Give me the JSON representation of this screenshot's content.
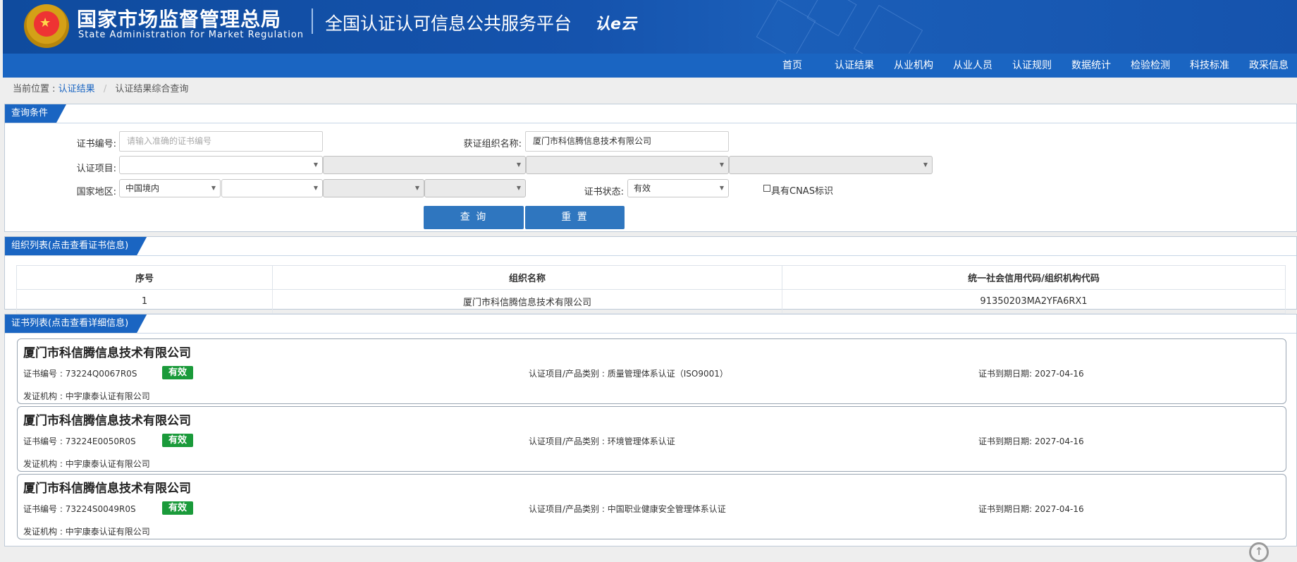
{
  "header": {
    "agency_cn": "国家市场监督管理总局",
    "agency_en": "State Administration  for  Market Regulation",
    "platform_title": "全国认证认可信息公共服务平台",
    "cloud_logo": "认e云"
  },
  "nav": [
    "首页",
    "认证结果",
    "从业机构",
    "从业人员",
    "认证规则",
    "数据统计",
    "检验检测",
    "科技标准",
    "政采信息"
  ],
  "breadcrumb": {
    "prefix": "当前位置 :",
    "link": "认证结果",
    "separator": "/",
    "current": "认证结果综合查询"
  },
  "query": {
    "tab": "查询条件",
    "cert_no_label": "证书编号:",
    "cert_no_placeholder": "请输入准确的证书编号",
    "org_name_label": "获证组织名称:",
    "org_name_value": "厦门市科信腾信息技术有限公司",
    "project_label": "认证项目:",
    "region_label": "国家地区:",
    "region_value": "中国境内",
    "status_label": "证书状态:",
    "status_value": "有效",
    "cnas_label": "具有CNAS标识",
    "query_button": "查 询",
    "reset_button": "重 置"
  },
  "org_list": {
    "tab": "组织列表(点击查看证书信息)",
    "columns": [
      "序号",
      "组织名称",
      "统一社会信用代码/组织机构代码"
    ],
    "rows": [
      [
        "1",
        "厦门市科信腾信息技术有限公司",
        "91350203MA2YFA6RX1"
      ]
    ]
  },
  "cert_list": {
    "tab": "证书列表(点击查看详细信息)",
    "cert_no_prefix": "证书编号 :",
    "category_prefix": "认证项目/产品类别 :",
    "expiry_prefix": "证书到期日期:",
    "issuer_prefix": "发证机构 :",
    "items": [
      {
        "org": "厦门市科信腾信息技术有限公司",
        "cert_no": "73224Q0067R0S",
        "status": "有效",
        "category": "质量管理体系认证（ISO9001）",
        "expiry": "2027-04-16",
        "issuer": "中宇康泰认证有限公司"
      },
      {
        "org": "厦门市科信腾信息技术有限公司",
        "cert_no": "73224E0050R0S",
        "status": "有效",
        "category": "环境管理体系认证",
        "expiry": "2027-04-16",
        "issuer": "中宇康泰认证有限公司"
      },
      {
        "org": "厦门市科信腾信息技术有限公司",
        "cert_no": "73224S0049R0S",
        "status": "有效",
        "category": "中国职业健康安全管理体系认证",
        "expiry": "2027-04-16",
        "issuer": "中宇康泰认证有限公司"
      }
    ]
  },
  "icons": {
    "emblem": "national-emblem-icon",
    "dropdown": "chevron-down-icon",
    "scroll_top": "arrow-up-circle-icon"
  },
  "colors": {
    "header_bg": "#1553ad",
    "nav_bg": "#1a65c2",
    "tab_bg": "#1a65c2",
    "button_bg": "#2f76bf",
    "valid_badge": "#1a9a3a"
  }
}
